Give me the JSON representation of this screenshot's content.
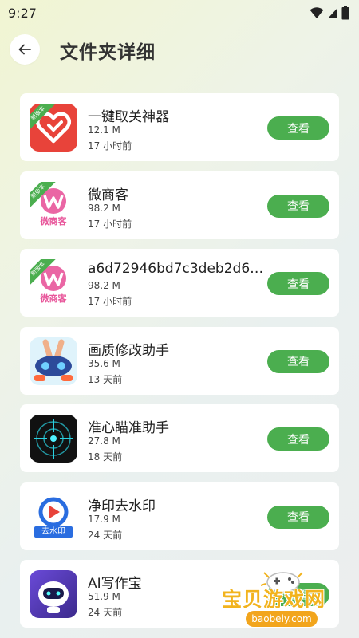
{
  "status_bar": {
    "time": "9:27"
  },
  "header": {
    "title": "文件夹详细"
  },
  "colors": {
    "accent": "#4bae4f",
    "card": "#ffffff"
  },
  "apps": [
    {
      "name": "一键取关神器",
      "size": "12.1 M",
      "time": "17 小时前",
      "button": "查看",
      "badge": "新版本",
      "icon": "heart-app-icon",
      "icon_color": "#e8433a",
      "icon_caption": ""
    },
    {
      "name": "微商客",
      "size": "98.2 M",
      "time": "17 小时前",
      "button": "查看",
      "badge": "新版本",
      "icon": "weishangke-app-icon",
      "icon_color": "#e8559a",
      "icon_caption": "微商客"
    },
    {
      "name": "a6d72946bd7c3deb2d662...",
      "size": "98.2 M",
      "time": "17 小时前",
      "button": "查看",
      "badge": "新版本",
      "icon": "weishangke-app-icon",
      "icon_color": "#e8559a",
      "icon_caption": "微商客"
    },
    {
      "name": "画质修改助手",
      "size": "35.6 M",
      "time": "13 天前",
      "button": "查看",
      "badge": "",
      "icon": "gamepad-app-icon",
      "icon_color": "#2c4a9a",
      "icon_caption": ""
    },
    {
      "name": "准心瞄准助手",
      "size": "27.8 M",
      "time": "18 天前",
      "button": "查看",
      "badge": "",
      "icon": "crosshair-app-icon",
      "icon_color": "#111111",
      "icon_caption": ""
    },
    {
      "name": "净印去水印",
      "size": "17.9 M",
      "time": "24 天前",
      "button": "查看",
      "badge": "",
      "icon": "play-app-icon",
      "icon_color": "#2a6de0",
      "icon_caption": "去水印"
    },
    {
      "name": "AI写作宝",
      "size": "51.9 M",
      "time": "24 天前",
      "button": "查看",
      "badge": "",
      "icon": "robot-app-icon",
      "icon_color": "#3c2a8c",
      "icon_caption": ""
    }
  ],
  "watermark": {
    "text": "宝贝游戏网",
    "url": "baobeiy.com"
  }
}
